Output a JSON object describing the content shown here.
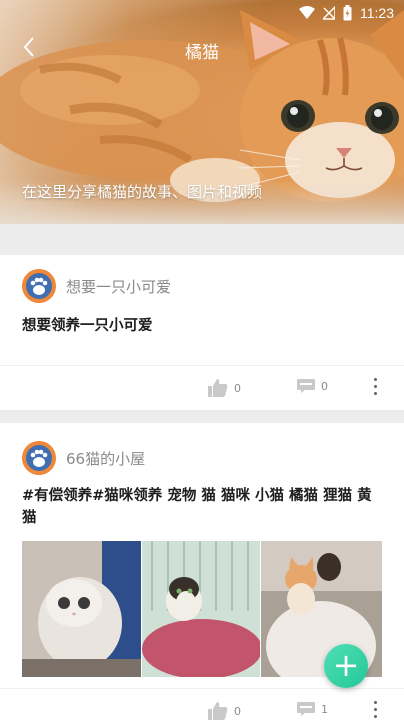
{
  "status_bar": {
    "time": "11:23"
  },
  "header": {
    "title": "橘猫",
    "description": "在这里分享橘猫的故事、图片和视频"
  },
  "posts": [
    {
      "author": "想要一只小可爱",
      "text": "想要领养一只小可爱",
      "likes": "0",
      "comments": "0"
    },
    {
      "author": "66猫的小屋",
      "text": "#有偿领养#猫咪领养 宠物 猫 猫咪 小猫 橘猫 狸猫 黄猫",
      "likes": "0",
      "comments": "1"
    }
  ],
  "fab": {
    "symbol": "+"
  },
  "colors": {
    "fab_accent": "#2fd3a5",
    "avatar_outer": "#f0883a",
    "avatar_inner": "#3f6fb0"
  }
}
